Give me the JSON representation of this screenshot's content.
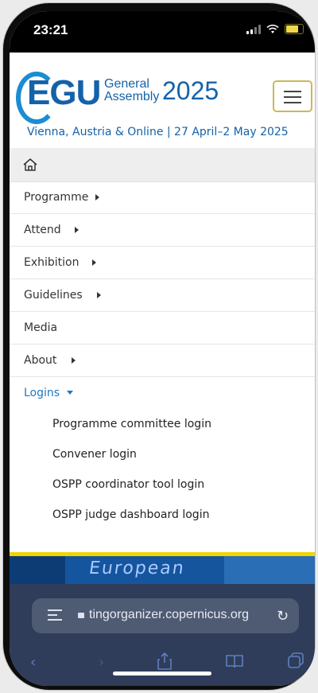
{
  "status_bar": {
    "time": "23:21",
    "icons": [
      "signal-icon",
      "wifi-icon",
      "battery-icon"
    ]
  },
  "header": {
    "logo": {
      "letters": "EGU",
      "general": "General",
      "assembly": "Assembly",
      "year": "2025"
    },
    "subtitle": "Vienna, Austria & Online | 27 April–2 May 2025",
    "menu_button_icon": "hamburger-icon"
  },
  "nav": {
    "home_icon": "home-icon",
    "items": [
      {
        "label": "Programme",
        "has_submenu": true
      },
      {
        "label": "Attend",
        "has_submenu": true
      },
      {
        "label": "Exhibition",
        "has_submenu": true
      },
      {
        "label": "Guidelines",
        "has_submenu": true
      },
      {
        "label": "Media",
        "has_submenu": false
      },
      {
        "label": "About",
        "has_submenu": true
      },
      {
        "label": "Logins",
        "has_submenu": true,
        "expanded": true
      }
    ],
    "logins_submenu": [
      "Programme committee login",
      "Convener login",
      "OSPP coordinator tool login",
      "OSPP judge dashboard login"
    ]
  },
  "banner": {
    "text": "European"
  },
  "browser": {
    "url": "tingorganizer.copernicus.org",
    "tabs_icon": "tabs-icon",
    "lock_icon": "lock-icon",
    "reload_icon": "reload-icon",
    "toolbar_icons": [
      "back-icon",
      "forward-icon",
      "share-icon",
      "bookmarks-icon",
      "tabs-overview-icon"
    ]
  },
  "colors": {
    "brand_blue": "#1462a8",
    "active_link": "#1f78c1",
    "menu_border": "#c9b85a"
  }
}
